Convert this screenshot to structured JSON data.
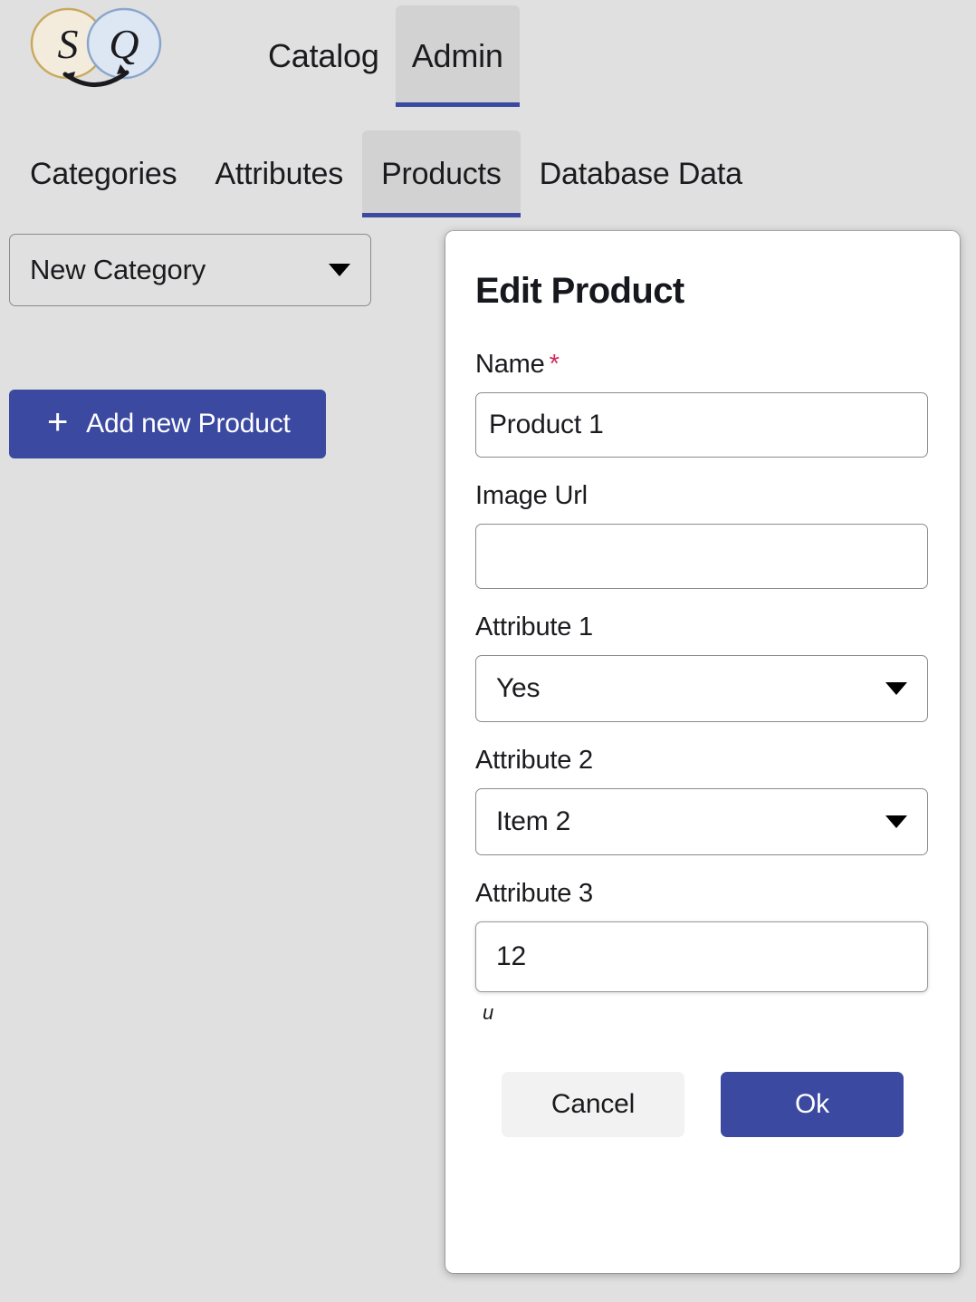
{
  "app": {
    "logo_letters": [
      "S",
      "Q"
    ],
    "logo_colors": {
      "left_fill": "#f3ecdd",
      "left_stroke": "#c8a95f",
      "right_fill": "#dde6f3",
      "right_stroke": "#8aa6cc"
    },
    "accent_color": "#3b4aa0",
    "page_background": "#e0e0e0"
  },
  "topnav": {
    "tabs": [
      {
        "label": "Catalog",
        "active": false
      },
      {
        "label": "Admin",
        "active": true
      }
    ]
  },
  "subnav": {
    "tabs": [
      {
        "label": "Categories",
        "active": false
      },
      {
        "label": "Attributes",
        "active": false
      },
      {
        "label": "Products",
        "active": true
      },
      {
        "label": "Database Data",
        "active": false
      }
    ]
  },
  "left_panel": {
    "category_select": {
      "value": "New Category",
      "icon": "chevron-down-icon"
    },
    "add_button": {
      "icon": "plus-icon",
      "label": "Add new Product"
    }
  },
  "modal": {
    "title": "Edit Product",
    "fields": {
      "name": {
        "label": "Name",
        "required_marker": "*",
        "value": "Product 1",
        "placeholder": ""
      },
      "image_url": {
        "label": "Image Url",
        "value": "",
        "placeholder": ""
      },
      "attribute_1": {
        "label": "Attribute 1",
        "value": "Yes",
        "icon": "chevron-down-icon"
      },
      "attribute_2": {
        "label": "Attribute 2",
        "value": "Item 2",
        "icon": "chevron-down-icon"
      },
      "attribute_3": {
        "label": "Attribute 3",
        "value": "12",
        "placeholder": "",
        "hint": "u"
      }
    },
    "actions": {
      "cancel_label": "Cancel",
      "ok_label": "Ok"
    }
  }
}
